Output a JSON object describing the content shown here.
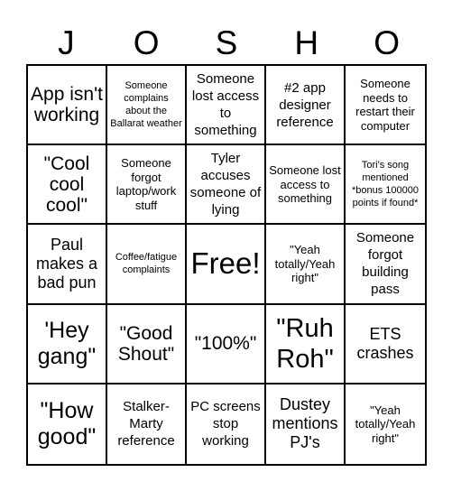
{
  "header": {
    "letters": [
      "J",
      "O",
      "S",
      "H",
      "O"
    ]
  },
  "board": {
    "cells": [
      "App isn't working",
      "Someone complains about the Ballarat weather",
      "Someone lost access to something",
      "#2 app designer reference",
      "Someone needs to restart their computer",
      "\"Cool cool cool\"",
      "Someone forgot laptop/work stuff",
      "Tyler accuses someone of lying",
      "Someone lost access to something",
      "Tori's song mentioned *bonus 100000 points if found*",
      "Paul makes a bad pun",
      "Coffee/fatigue complaints",
      "Free!",
      "\"Yeah totally/Yeah right\"",
      "Someone forgot building pass",
      "'Hey gang\"",
      "\"Good Shout\"",
      "\"100%\"",
      "\"Ruh Roh\"",
      "ETS crashes",
      "\"How good\"",
      "Stalker-Marty reference",
      "PC screens stop working",
      "Dustey mentions PJ's",
      "\"Yeah totally/Yeah right\""
    ]
  }
}
